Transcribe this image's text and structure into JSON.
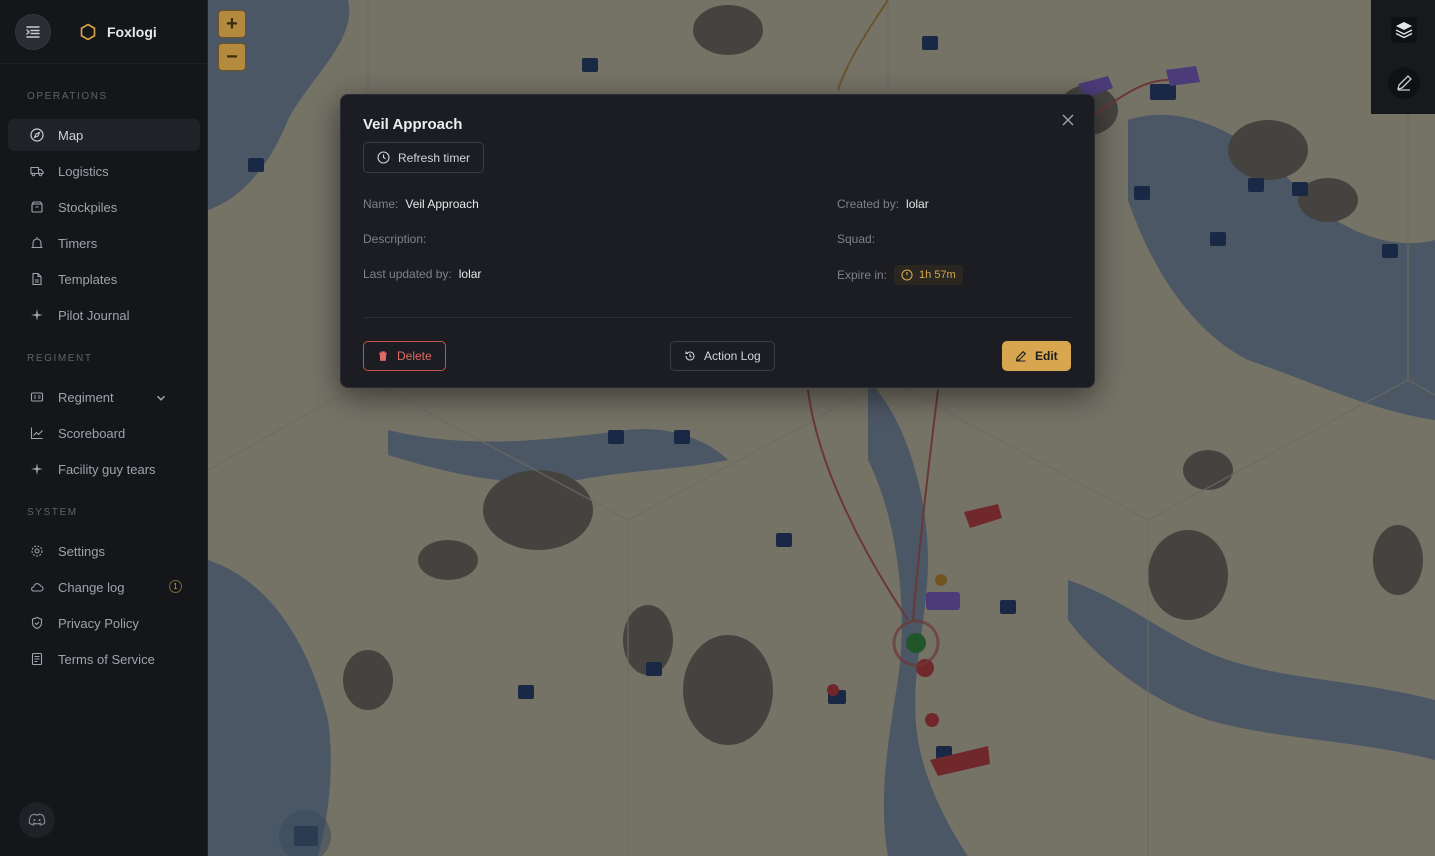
{
  "app": {
    "name": "Foxlogi"
  },
  "sidebar": {
    "sections": [
      {
        "title": "OPERATIONS"
      },
      {
        "title": "REGIMENT"
      },
      {
        "title": "SYSTEM"
      }
    ],
    "items": [
      {
        "label": "Map",
        "icon": "compass-icon",
        "active": true
      },
      {
        "label": "Logistics",
        "icon": "truck-icon"
      },
      {
        "label": "Stockpiles",
        "icon": "box-icon"
      },
      {
        "label": "Timers",
        "icon": "alarm-icon"
      },
      {
        "label": "Templates",
        "icon": "file-icon"
      },
      {
        "label": "Pilot Journal",
        "icon": "plane-icon"
      },
      {
        "label": "Regiment",
        "icon": "id-card-icon"
      },
      {
        "label": "Scoreboard",
        "icon": "chart-icon"
      },
      {
        "label": "Facility guy tears",
        "icon": "plane-icon"
      },
      {
        "label": "Settings",
        "icon": "gear-icon"
      },
      {
        "label": "Change log",
        "icon": "cloud-icon",
        "badge": "1"
      },
      {
        "label": "Privacy Policy",
        "icon": "shield-icon"
      },
      {
        "label": "Terms of Service",
        "icon": "document-icon"
      }
    ]
  },
  "map_controls": {
    "zoom_in": "+",
    "zoom_out": "−"
  },
  "modal": {
    "title": "Veil Approach",
    "refresh_label": "Refresh timer",
    "fields": {
      "name_label": "Name",
      "name_value": "Veil Approach",
      "description_label": "Description",
      "description_value": "",
      "last_updated_label": "Last updated by",
      "last_updated_value": "lolar",
      "created_by_label": "Created by",
      "created_by_value": "lolar",
      "squad_label": "Squad",
      "squad_value": "",
      "expire_label": "Expire in",
      "expire_value": "1h 57m"
    },
    "delete_label": "Delete",
    "action_log_label": "Action Log",
    "edit_label": "Edit"
  },
  "colors": {
    "accent": "#d9a650",
    "danger": "#c4524f",
    "map_land": "#c9c1a8",
    "map_water": "#7a8ea6"
  }
}
